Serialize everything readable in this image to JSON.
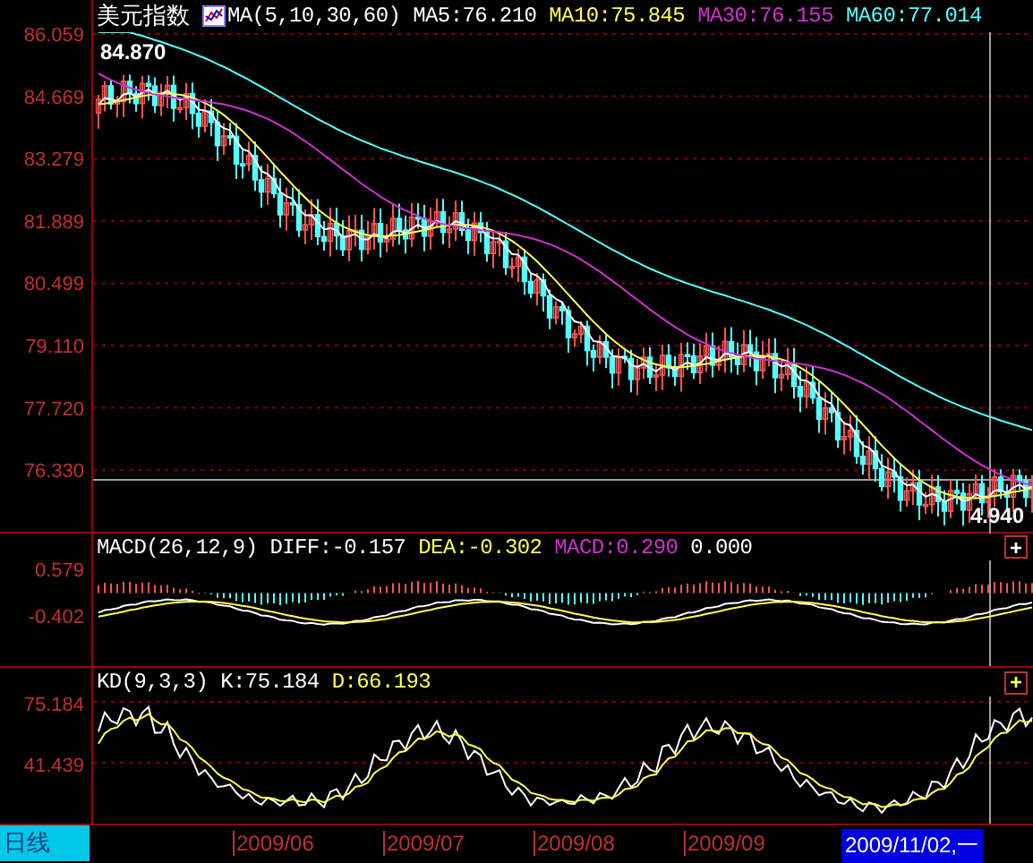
{
  "main": {
    "title": "美元指数",
    "indicator": "MA(5,10,30,60)",
    "values": [
      {
        "text": "MA5:76.210",
        "color": "#ffffff"
      },
      {
        "text": "MA10:75.845",
        "color": "#ffff54"
      },
      {
        "text": "MA30:76.155",
        "color": "#d030d0"
      },
      {
        "text": "MA60:77.014",
        "color": "#54ffff"
      }
    ],
    "yticks": [
      "86.059",
      "84.669",
      "83.279",
      "81.889",
      "80.499",
      "79.110",
      "77.720",
      "76.330"
    ],
    "high_label": "84.870",
    "low_label": "4.940"
  },
  "macd": {
    "indicator": "MACD(26,12,9)",
    "values": [
      {
        "text": "DIFF:-0.157",
        "color": "#ffffff"
      },
      {
        "text": "DEA:-0.302",
        "color": "#ffff54"
      },
      {
        "text": "MACD:0.290",
        "color": "#d030d0"
      },
      {
        "text": "0.000",
        "color": "#ffffff"
      }
    ],
    "yticks": [
      "0.579",
      "-0.402"
    ],
    "button": "+"
  },
  "kd": {
    "indicator": "KD(9,3,3)",
    "values": [
      {
        "text": "K:75.184",
        "color": "#ffffff"
      },
      {
        "text": "D:66.193",
        "color": "#ffff54"
      }
    ],
    "yticks": [
      "75.184",
      "41.439"
    ],
    "button": "+"
  },
  "bottom_bar": {
    "period": "日线",
    "dates": [
      "2009/06",
      "2009/07",
      "2009/08",
      "2009/09"
    ],
    "cursor_date": "2009/11/02,一"
  }
}
